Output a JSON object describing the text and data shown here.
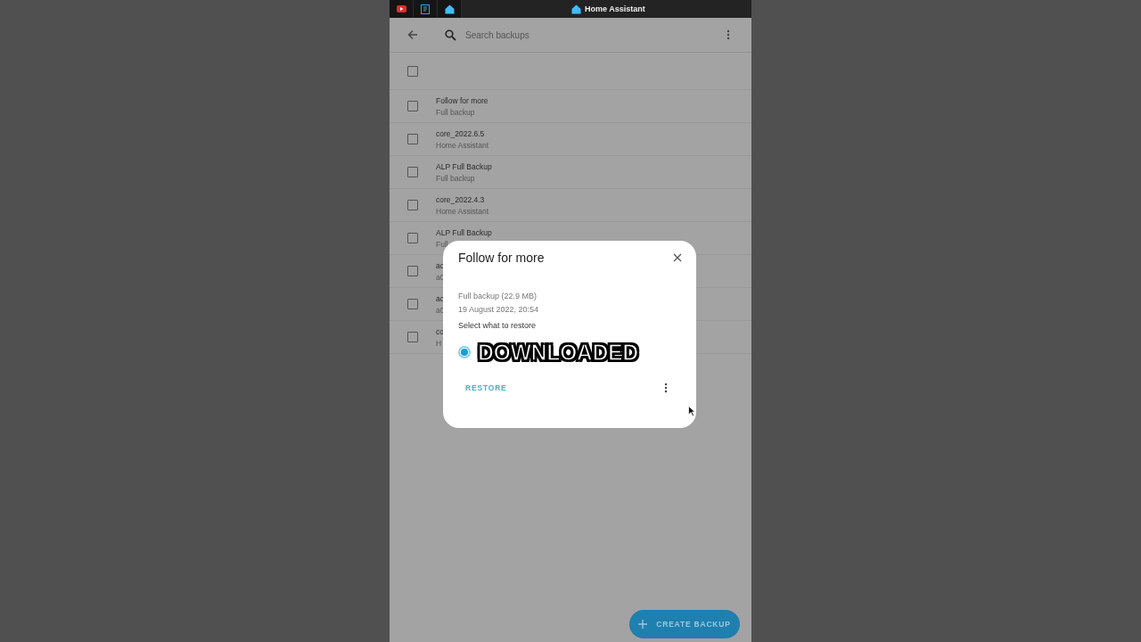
{
  "title_bar": {
    "tabs": [
      {
        "kind": "video"
      },
      {
        "kind": "book"
      },
      {
        "kind": "home"
      }
    ],
    "title": "Home Assistant"
  },
  "search": {
    "placeholder": "Search backups"
  },
  "select_all": {
    "checked": false
  },
  "backups": [
    {
      "name": "Follow for more",
      "type": "Full backup",
      "checked": false
    },
    {
      "name": "core_2022.6.5",
      "type": "Home Assistant",
      "checked": false
    },
    {
      "name": "ALP Full Backup",
      "type": "Full backup",
      "checked": false
    },
    {
      "name": "core_2022.4.3",
      "type": "Home Assistant",
      "checked": false
    },
    {
      "name": "ALP Full Backup",
      "type": "Full",
      "checked": false
    },
    {
      "name": "ac",
      "type": "a0",
      "checked": false
    },
    {
      "name": "ac",
      "type": "a0",
      "checked": false
    },
    {
      "name": "co",
      "type": "H",
      "checked": false
    }
  ],
  "dialog": {
    "title": "Follow for more",
    "details": [
      "Full backup (22.9 MB)",
      "19 August 2022, 20:54"
    ],
    "prompt": "Select what to restore",
    "option": {
      "selected": true
    },
    "caption": "DOWNLOADED",
    "action": "RESTORE"
  },
  "fab": {
    "label": "CREATE BACKUP"
  }
}
